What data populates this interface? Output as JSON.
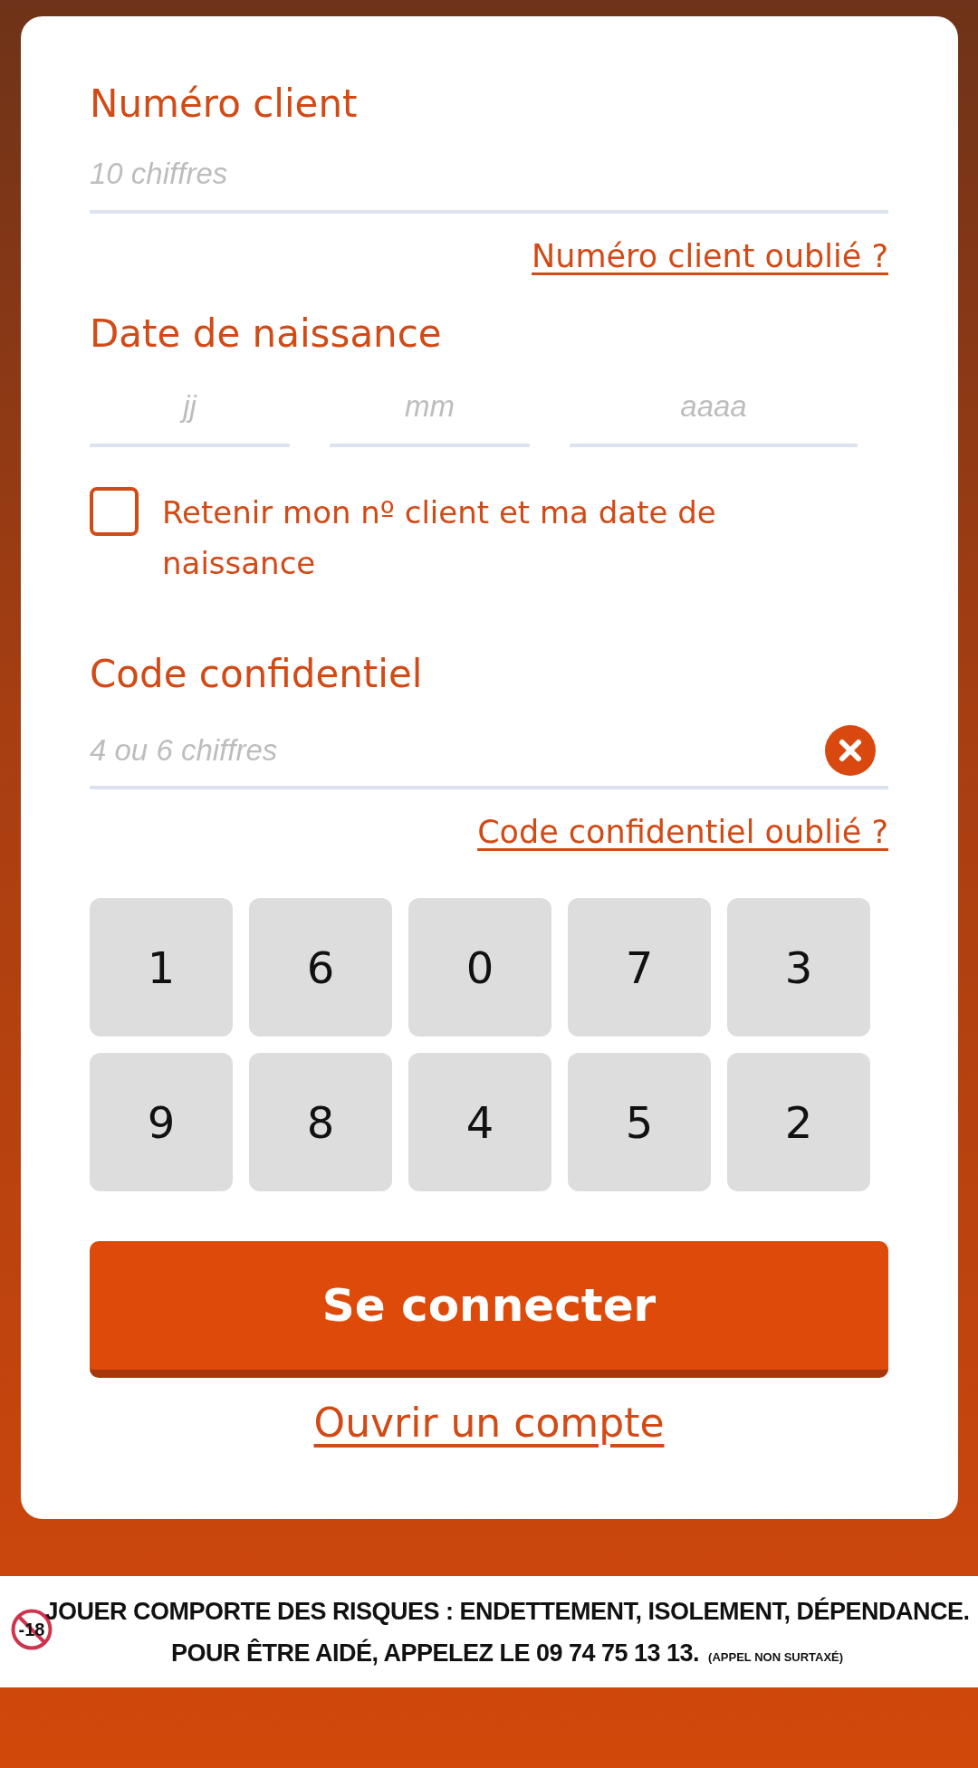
{
  "login_form": {
    "client_number": {
      "label": "Numéro client",
      "placeholder": "10 chiffres",
      "forgot_link": "Numéro client oublié ?"
    },
    "birth_date": {
      "label": "Date de naissance",
      "fields": [
        {
          "placeholder": "jj"
        },
        {
          "placeholder": "mm"
        },
        {
          "placeholder": "aaaa"
        }
      ]
    },
    "remember": {
      "label": "Retenir mon nº client et ma date de naissance",
      "checked": false
    },
    "secret_code": {
      "label": "Code confidentiel",
      "placeholder": "4 ou 6 chiffres",
      "forgot_link": "Code confidentiel oublié ?"
    },
    "keypad": [
      "1",
      "6",
      "0",
      "7",
      "3",
      "9",
      "8",
      "4",
      "5",
      "2"
    ],
    "submit_button": "Se connecter",
    "open_account_link": "Ouvrir un compte"
  },
  "warning_banner": {
    "line_1": "JOUER COMPORTE DES RISQUES : ENDETTEMENT, ISOLEMENT, DÉPENDANCE.",
    "line_2": "POUR ÊTRE AIDÉ, APPELEZ LE 09 74 75 13 13.",
    "note": "(APPEL NON SURTAXÉ)",
    "age_badge": "-18"
  }
}
